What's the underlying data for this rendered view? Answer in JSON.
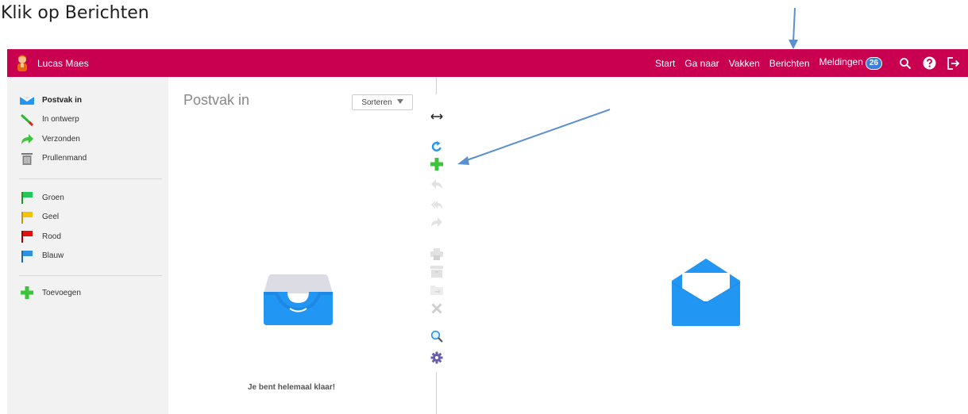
{
  "instruction": "Klik op Berichten",
  "header": {
    "user_name": "Lucas Maes",
    "nav": {
      "start": "Start",
      "go_to": "Ga naar",
      "subjects": "Vakken",
      "messages": "Berichten",
      "notifications": "Meldingen",
      "notifications_count": "26"
    },
    "icons": [
      "search-icon",
      "help-icon",
      "logout-icon"
    ],
    "bar_color": "#c8004f"
  },
  "sidebar": {
    "folders": [
      {
        "label": "Postvak in",
        "icon": "inbox-icon",
        "active": true
      },
      {
        "label": "In ontwerp",
        "icon": "pencil-icon",
        "active": false
      },
      {
        "label": "Verzonden",
        "icon": "sent-arrow-icon",
        "active": false
      },
      {
        "label": "Prullenmand",
        "icon": "trash-icon",
        "active": false
      }
    ],
    "flags": [
      {
        "label": "Groen",
        "icon": "flag-green-icon",
        "color": "#22c55e"
      },
      {
        "label": "Geel",
        "icon": "flag-yellow-icon",
        "color": "#f5c400"
      },
      {
        "label": "Rood",
        "icon": "flag-red-icon",
        "color": "#e01010"
      },
      {
        "label": "Blauw",
        "icon": "flag-blue-icon",
        "color": "#2f8fe0"
      }
    ],
    "add_label": "Toevoegen"
  },
  "list": {
    "title": "Postvak in",
    "sort_label": "Sorteren",
    "empty_text": "Je bent helemaal klaar!"
  },
  "toolbar": {
    "buttons": [
      "resize-icon",
      "refresh-icon",
      "new-message-icon",
      "reply-icon",
      "reply-all-icon",
      "forward-icon",
      "print-icon",
      "archive-icon",
      "move-folder-icon",
      "delete-icon",
      "search-icon",
      "settings-icon"
    ]
  },
  "colors": {
    "accent_blue": "#2196f3",
    "add_green": "#3cc43c",
    "annotation_arrow": "#5b8fd0"
  }
}
